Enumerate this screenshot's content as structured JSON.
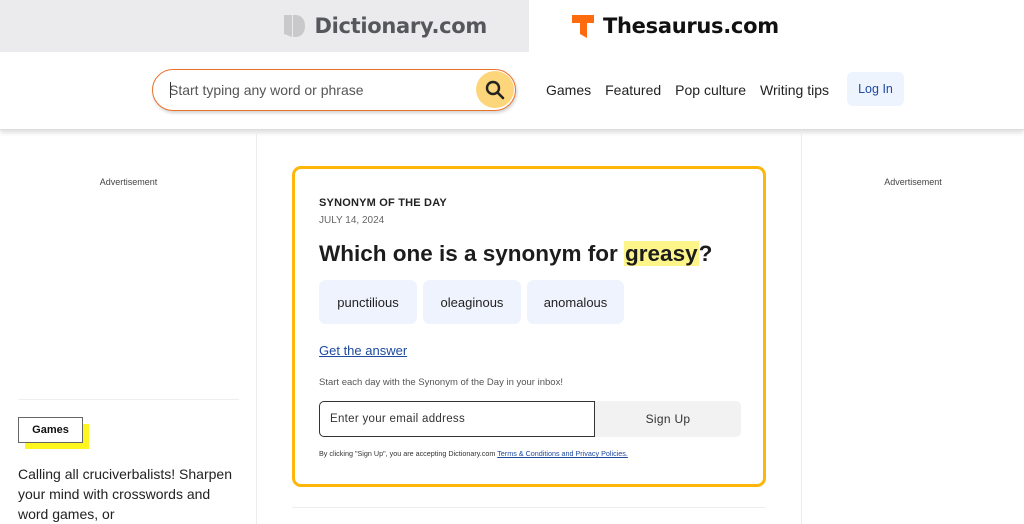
{
  "brand_tabs": [
    {
      "label": "Dictionary.com",
      "icon": "dictionary-logo-icon",
      "active": false
    },
    {
      "label": "Thesaurus.com",
      "icon": "thesaurus-logo-icon",
      "active": true
    }
  ],
  "colors": {
    "accent_orange": "#e9722b",
    "search_button": "#fdd57a",
    "card_border": "#ffb60a",
    "highlight": "#fdf58a",
    "link_blue": "#1e4aa0",
    "games_tag_shadow": "#fff61f"
  },
  "header": {
    "search": {
      "placeholder": "Start typing any word or phrase",
      "value": "",
      "button_icon": "search-icon"
    },
    "nav": [
      "Games",
      "Featured",
      "Pop culture",
      "Writing tips"
    ],
    "login_label": "Log In"
  },
  "left_sidebar": {
    "ad_label": "Advertisement",
    "games_tag": "Games",
    "games_description": "Calling all cruciverbalists! Sharpen your mind with crosswords and word games, or"
  },
  "right_sidebar": {
    "ad_label": "Advertisement"
  },
  "synonym_of_the_day": {
    "title": "SYNONYM OF THE DAY",
    "date": "JULY 14, 2024",
    "question_prefix": "Which one is a synonym for ",
    "word": "greasy",
    "question_suffix": "?",
    "options": [
      "punctilious",
      "oleaginous",
      "anomalous"
    ],
    "answer_link": "Get the answer",
    "inbox_text": "Start each day with the Synonym of the Day in your inbox!",
    "email_placeholder": "Enter your email address",
    "email_value": "",
    "signup_label": "Sign Up",
    "terms_prefix": "By clicking \"Sign Up\", you are accepting Dictionary.com ",
    "terms_link": "Terms & Conditions and Privacy Policies."
  }
}
